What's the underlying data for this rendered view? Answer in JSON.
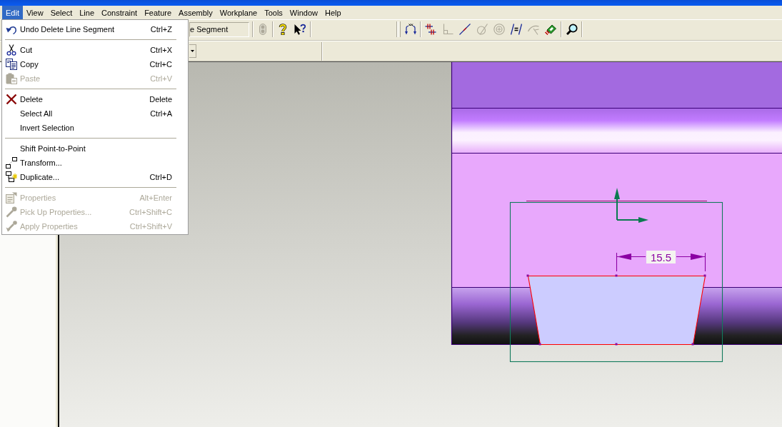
{
  "menu_bar": [
    {
      "label": "Edit",
      "selected": true
    },
    {
      "label": "View",
      "selected": false
    },
    {
      "label": "Select",
      "selected": false
    },
    {
      "label": "Line",
      "selected": false
    },
    {
      "label": "Constraint",
      "selected": false
    },
    {
      "label": "Feature",
      "selected": false
    },
    {
      "label": "Assembly",
      "selected": false
    },
    {
      "label": "Workplane",
      "selected": false
    },
    {
      "label": "Tools",
      "selected": false
    },
    {
      "label": "Window",
      "selected": false
    },
    {
      "label": "Help",
      "selected": false
    }
  ],
  "toolbar": {
    "command_field": {
      "value": "e Segment"
    },
    "buttons": [
      {
        "disabled": true
      },
      {
        "disabled": false
      },
      {
        "disabled": false
      }
    ]
  },
  "constraint_toolbar": {
    "buttons": [
      {
        "disabled": false
      },
      {
        "disabled": false
      },
      {
        "disabled": true
      },
      {
        "disabled": false
      },
      {
        "disabled": true
      },
      {
        "disabled": true
      },
      {
        "disabled": false
      },
      {
        "disabled": true
      },
      {
        "disabled": false
      },
      {
        "disabled": false
      }
    ]
  },
  "edit_menu": {
    "groups": [
      [
        {
          "label": "Undo Delete Line Segment",
          "shortcut": "Ctrl+Z",
          "disabled": false
        }
      ],
      [
        {
          "label": "Cut",
          "shortcut": "Ctrl+X",
          "disabled": false
        },
        {
          "label": "Copy",
          "shortcut": "Ctrl+C",
          "disabled": false
        },
        {
          "label": "Paste",
          "shortcut": "Ctrl+V",
          "disabled": true
        }
      ],
      [
        {
          "label": "Delete",
          "shortcut": "Delete",
          "disabled": false
        },
        {
          "label": "Select All",
          "shortcut": "Ctrl+A",
          "disabled": false
        },
        {
          "label": "Invert Selection",
          "disabled": false
        }
      ],
      [
        {
          "label": "Shift Point-to-Point",
          "disabled": false
        },
        {
          "label": "Transform...",
          "disabled": false
        },
        {
          "label": "Duplicate...",
          "shortcut": "Ctrl+D",
          "disabled": false
        }
      ],
      [
        {
          "label": "Properties",
          "shortcut": "Alt+Enter",
          "disabled": true
        },
        {
          "label": "Pick Up Properties...",
          "shortcut": "Ctrl+Shift+C",
          "disabled": true
        },
        {
          "label": "Apply Properties",
          "shortcut": "Ctrl+Shift+V",
          "disabled": true
        }
      ]
    ]
  },
  "sketch": {
    "dimension": "15.5"
  }
}
